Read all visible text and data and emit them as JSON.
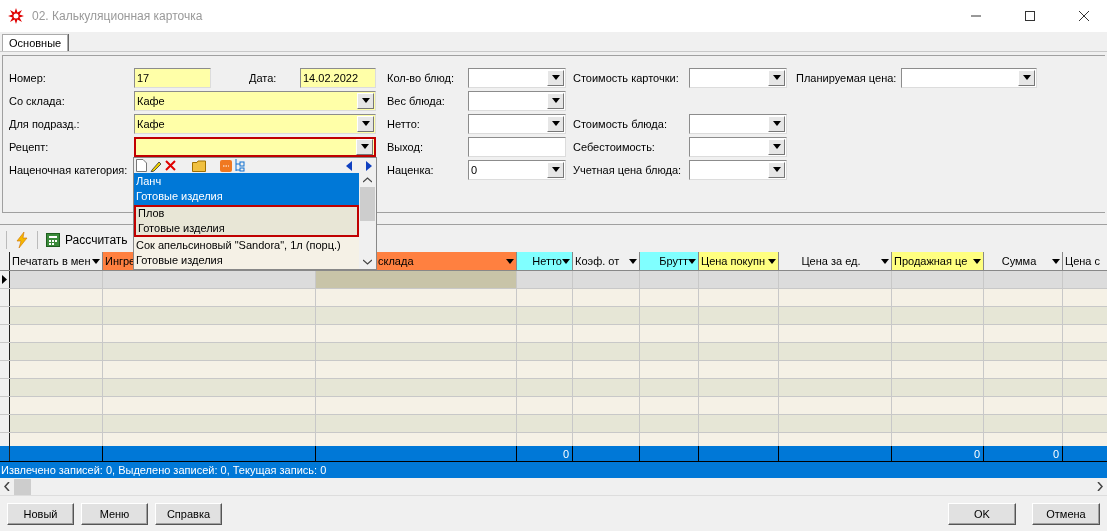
{
  "window": {
    "title": "02. Калькуляционная карточка"
  },
  "tabs": [
    {
      "label": "Основные",
      "selected": true
    }
  ],
  "form": {
    "columns": [
      {
        "fields": [
          {
            "kind": "pair",
            "label": "Номер:",
            "value": "17",
            "required": true,
            "second": {
              "label": "Дата:",
              "value": "14.02.2022",
              "required": true
            }
          },
          {
            "kind": "combo",
            "label": "Со склада:",
            "value": "Кафе",
            "required": true,
            "focused": false
          },
          {
            "kind": "combo",
            "label": "Для подразд.:",
            "value": "Кафе",
            "required": true,
            "focused": false
          },
          {
            "kind": "combo",
            "label": "Рецепт:",
            "required": true,
            "focused": true
          },
          {
            "kind": "label",
            "label": "Наценочная категория:"
          }
        ]
      },
      {
        "fields": [
          {
            "kind": "combo",
            "label": "Кол-во блюд:",
            "required": false,
            "focused": false
          },
          {
            "kind": "combo",
            "label": "Вес блюда:",
            "required": false,
            "focused": false
          },
          {
            "kind": "combo",
            "label": "Нетто:",
            "required": false,
            "focused": false
          },
          {
            "kind": "text",
            "label": "Выход:",
            "required": false
          },
          {
            "kind": "combo",
            "label": "Наценка:",
            "value": "0",
            "required": false,
            "focused": false
          }
        ]
      },
      {
        "fields": [
          {
            "kind": "combo",
            "label": "Стоимость карточки:",
            "required": false,
            "focused": false
          },
          {
            "kind": "spacer"
          },
          {
            "kind": "combo",
            "label": "Стоимость блюда:",
            "required": false,
            "focused": false
          },
          {
            "kind": "combo",
            "label": "Себестоимость:",
            "required": false,
            "focused": false
          },
          {
            "kind": "combo",
            "label": "Учетная цена блюда:",
            "required": false,
            "focused": false
          }
        ]
      },
      {
        "fields": [
          {
            "kind": "combo",
            "label": "Планируемая цена:",
            "required": false,
            "focused": false
          }
        ]
      }
    ]
  },
  "popup": {
    "items": [
      {
        "name": "Ланч",
        "group": "Готовые изделия",
        "selected": true,
        "focused": false
      },
      {
        "name": "Плов",
        "group": "Готовые изделия",
        "selected": false,
        "focused": true
      },
      {
        "name": "Сок апельсиновый \"Sandora\", 1л (порц.)",
        "group": "Готовые изделия",
        "selected": false,
        "focused": false
      }
    ]
  },
  "toolbar": {
    "calculate": "Рассчитать"
  },
  "grid": {
    "columns": [
      {
        "label": "Печатать в мен",
        "color": "#f0f0f0"
      },
      {
        "label": "Ингре",
        "color": "#ff8040"
      },
      {
        "label": "склада",
        "color": "#ff8040"
      },
      {
        "label": "Нетто",
        "color": "#80ffff",
        "total": "0"
      },
      {
        "label": "Коэф. от",
        "color": "#f0f0f0"
      },
      {
        "label": "Брутт",
        "color": "#80ffff"
      },
      {
        "label": "Цена покупн",
        "color": "#ffff80"
      },
      {
        "label": "Цена за ед.",
        "color": "#f0f0f0"
      },
      {
        "label": "Продажная це",
        "color": "#ffff80",
        "total": "0"
      },
      {
        "label": "Сумма",
        "color": "#f0f0f0",
        "total": "0"
      },
      {
        "label": "Цена с",
        "color": "#f0f0f0"
      }
    ],
    "rows": [
      {
        "current": true
      },
      {
        "current": false
      },
      {
        "current": false
      },
      {
        "current": false
      },
      {
        "current": false
      },
      {
        "current": false
      },
      {
        "current": false
      },
      {
        "current": false
      },
      {
        "current": false
      },
      {
        "current": false
      }
    ]
  },
  "status_bar": "Извлечено записей: 0, Выделено записей: 0, Текущая запись: 0",
  "buttons_left": [
    "Новый",
    "Меню",
    "Справка"
  ],
  "buttons_right": [
    "OK",
    "Отмена"
  ]
}
